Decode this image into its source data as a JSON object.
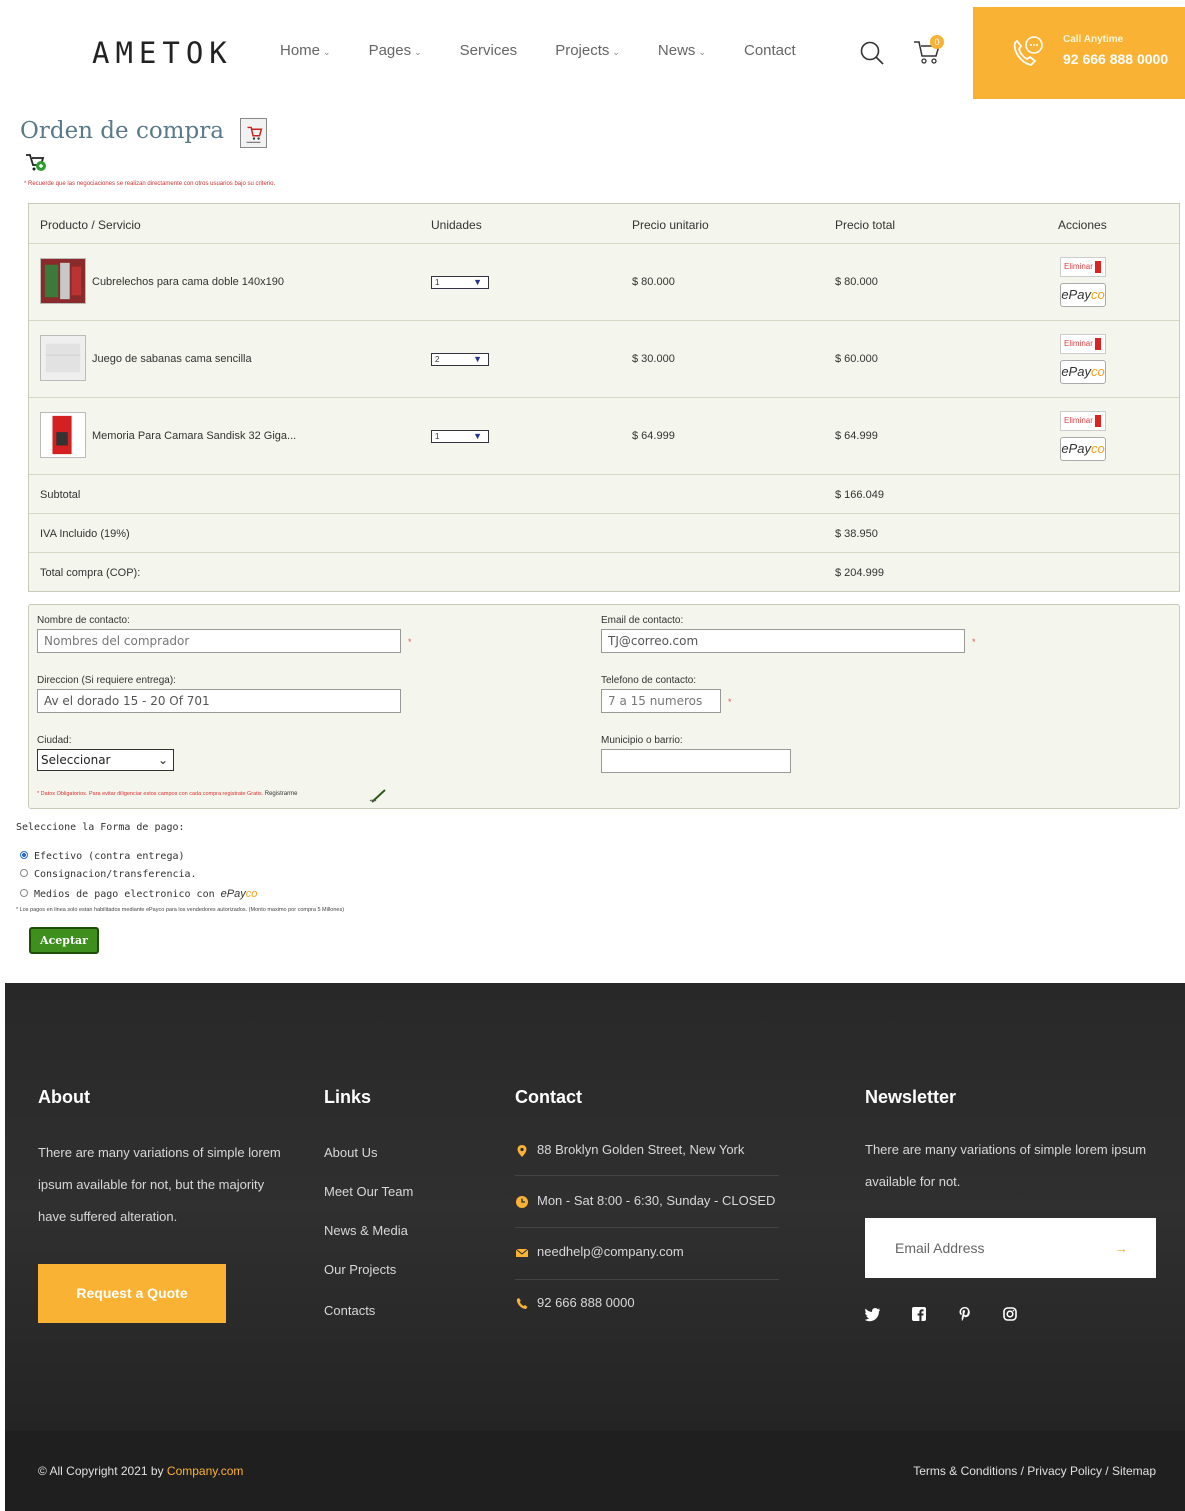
{
  "header": {
    "logo": "AMETOK",
    "nav": [
      {
        "label": "Home",
        "dropdown": true
      },
      {
        "label": "Pages",
        "dropdown": true
      },
      {
        "label": "Services",
        "dropdown": false
      },
      {
        "label": "Projects",
        "dropdown": true
      },
      {
        "label": "News",
        "dropdown": true
      },
      {
        "label": "Contact",
        "dropdown": false
      }
    ],
    "cart_count": "0",
    "call_label": "Call Anytime",
    "call_number": "92 666 888 0000"
  },
  "order": {
    "title": "Orden de compra",
    "note": "* Recuerde que las negociaciones se realizan directamente con otros usuarios bajo su criterio.",
    "columns": [
      "Producto / Servicio",
      "Unidades",
      "Precio unitario",
      "Precio total",
      "Acciones"
    ],
    "rows": [
      {
        "name": "Cubrelechos para cama doble 140x190",
        "qty": "1",
        "unit": "$ 80.000",
        "total": "$ 80.000"
      },
      {
        "name": "Juego de sabanas cama sencilla",
        "qty": "2",
        "unit": "$ 30.000",
        "total": "$ 60.000"
      },
      {
        "name": "Memoria Para Camara Sandisk 32 Giga...",
        "qty": "1",
        "unit": "$ 64.999",
        "total": "$ 64.999"
      }
    ],
    "actions": {
      "delete": "Eliminar",
      "pay_e": "e",
      "pay_pay": "Pay",
      "pay_co": "co"
    },
    "subtotal_label": "Subtotal",
    "subtotal_value": "$ 166.049",
    "iva_label": "IVA Incluido (19%)",
    "iva_value": "$ 38.950",
    "total_label": "Total compra (COP):",
    "total_value": "$ 204.999"
  },
  "form": {
    "name_label": "Nombre de contacto:",
    "name_placeholder": "Nombres del comprador",
    "email_label": "Email de contacto:",
    "email_value": "TJ@correo.com",
    "address_label": "Direccion (Si requiere entrega):",
    "address_value": "Av el dorado 15 - 20 Of 701",
    "phone_label": "Telefono de contacto:",
    "phone_placeholder": "7 a 15 numeros",
    "city_label": "Ciudad:",
    "city_value": "Seleccionar",
    "municipality_label": "Municipio o barrio:",
    "required_star": "*",
    "note": "* Datos Obligatorios. Para evitar diligenciar estos campos con cada compra registrate Gratis.",
    "register_label": "Registrarme"
  },
  "payment": {
    "title": "Seleccione la Forma de pago:",
    "options": [
      {
        "label": "Efectivo (contra entrega)",
        "selected": true
      },
      {
        "label": "Consignacion/transferencia.",
        "selected": false
      },
      {
        "label": "Medios de pago electronico con",
        "selected": false
      }
    ],
    "note": "* Los pagos en linea solo estan habilitados mediante ePayco para los vendedores autorizados. (Monto maximo por compra 5 Millones)",
    "accept_label": "Aceptar"
  },
  "footer": {
    "about_title": "About",
    "about_text": "There are many variations of simple lorem ipsum available for not, but the majority have suffered alteration.",
    "quote_button": "Request a Quote",
    "links_title": "Links",
    "links": [
      "About Us",
      "Meet Our Team",
      "News & Media",
      "Our Projects",
      "Contacts"
    ],
    "contact_title": "Contact",
    "contact": {
      "address": "88 Broklyn Golden Street, New York",
      "hours": "Mon - Sat 8:00 - 6:30, Sunday - CLOSED",
      "email": "needhelp@company.com",
      "phone": "92 666 888 0000"
    },
    "newsletter_title": "Newsletter",
    "newsletter_text": "There are many variations of simple lorem ipsum available for not.",
    "newsletter_placeholder": "Email Address",
    "newsletter_arrow": "→",
    "copyright_prefix": "© All Copyright 2021 by ",
    "copyright_brand": "Company.com",
    "legal": "Terms & Conditions  /  Privacy Policy  /  Sitemap"
  },
  "colors": {
    "accent": "#f9b233",
    "footer_bg": "#2a2a2a",
    "table_bg": "#f4f5ec",
    "accept_green": "#3f8f1e"
  }
}
